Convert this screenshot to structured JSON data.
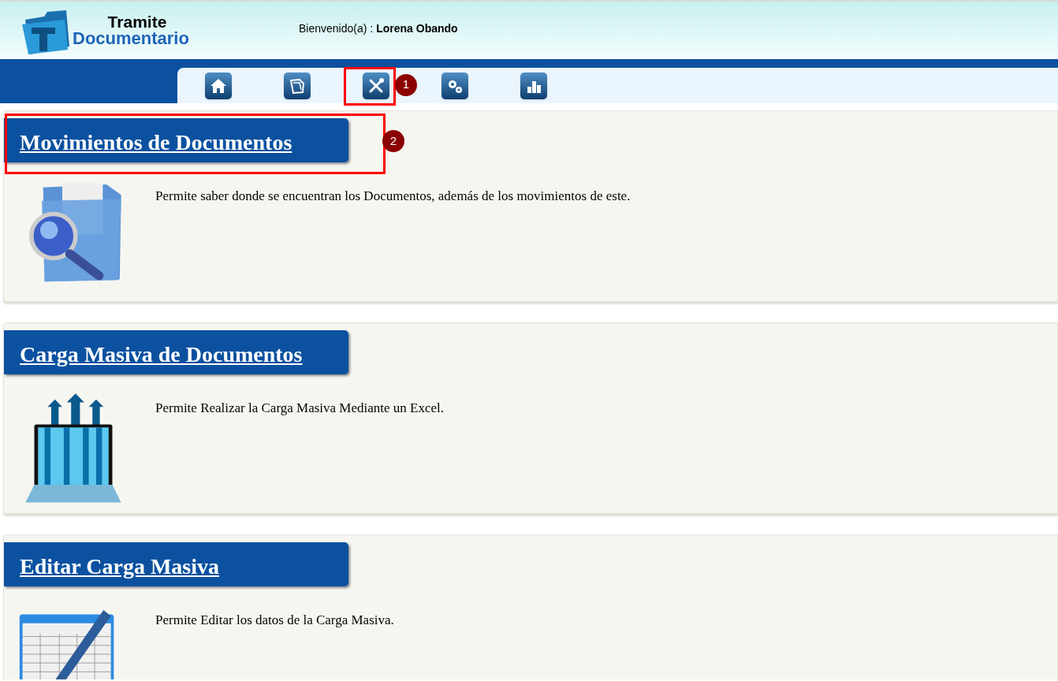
{
  "header": {
    "logo_line_1": "Tramite",
    "logo_line_2": "Documentario",
    "welcome_label": "Bienvenido(a) :",
    "user_name": "Lorena Obando"
  },
  "nav": [
    {
      "kind": "home",
      "highlighted": false
    },
    {
      "kind": "folder",
      "highlighted": false
    },
    {
      "kind": "tools",
      "highlighted": true,
      "callout": "1"
    },
    {
      "kind": "gears",
      "highlighted": false
    },
    {
      "kind": "chart",
      "highlighted": false
    }
  ],
  "cards": [
    {
      "kind": "search-folder",
      "title": "Movimientos de Documentos",
      "description": "Permite saber donde se encuentran los Documentos, además de los movimientos de este.",
      "highlighted": true,
      "callout": "2"
    },
    {
      "kind": "upload-laptop",
      "title": "Carga Masiva de Documentos",
      "description": "Permite Realizar la Carga Masiva Mediante un Excel.",
      "highlighted": false
    },
    {
      "kind": "spreadsheet-pen",
      "title": "Editar Carga Masiva",
      "description": "Permite Editar los datos de la Carga Masiva.",
      "highlighted": false
    }
  ]
}
